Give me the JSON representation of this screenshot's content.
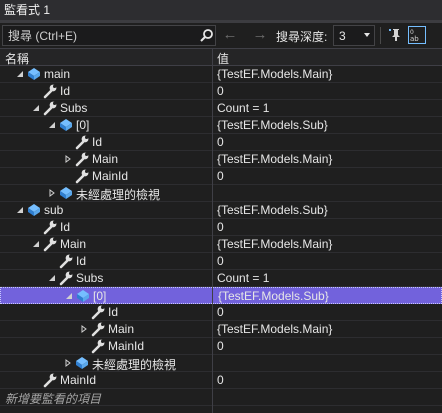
{
  "window": {
    "title": "監看式 1"
  },
  "toolbar": {
    "search_placeholder": "搜尋 (Ctrl+E)",
    "depth_label": "搜尋深度:",
    "depth_value": "3"
  },
  "columns": {
    "name": "名稱",
    "value": "值"
  },
  "rows": [
    {
      "level": 0,
      "expander": "expanded",
      "icon": "object-icon",
      "name": "main",
      "value": "{TestEF.Models.Main}"
    },
    {
      "level": 1,
      "expander": "none",
      "icon": "wrench-icon",
      "name": "Id",
      "value": "0"
    },
    {
      "level": 1,
      "expander": "expanded",
      "icon": "wrench-icon",
      "name": "Subs",
      "value": "Count = 1"
    },
    {
      "level": 2,
      "expander": "expanded",
      "icon": "object-icon",
      "name": "[0]",
      "value": "{TestEF.Models.Sub}"
    },
    {
      "level": 3,
      "expander": "none",
      "icon": "wrench-icon",
      "name": "Id",
      "value": "0"
    },
    {
      "level": 3,
      "expander": "collapsed",
      "icon": "wrench-icon",
      "name": "Main",
      "value": "{TestEF.Models.Main}"
    },
    {
      "level": 3,
      "expander": "none",
      "icon": "wrench-icon",
      "name": "MainId",
      "value": "0"
    },
    {
      "level": 2,
      "expander": "collapsed",
      "icon": "object-icon",
      "name": "未經處理的檢視",
      "value": ""
    },
    {
      "level": 0,
      "expander": "expanded",
      "icon": "object-icon",
      "name": "sub",
      "value": "{TestEF.Models.Sub}"
    },
    {
      "level": 1,
      "expander": "none",
      "icon": "wrench-icon",
      "name": "Id",
      "value": "0"
    },
    {
      "level": 1,
      "expander": "expanded",
      "icon": "wrench-icon",
      "name": "Main",
      "value": "{TestEF.Models.Main}"
    },
    {
      "level": 2,
      "expander": "none",
      "icon": "wrench-icon",
      "name": "Id",
      "value": "0"
    },
    {
      "level": 2,
      "expander": "expanded",
      "icon": "wrench-icon",
      "name": "Subs",
      "value": "Count = 1"
    },
    {
      "level": 3,
      "expander": "expanded",
      "icon": "object-icon",
      "name": "[0]",
      "value": "{TestEF.Models.Sub}",
      "selected": true
    },
    {
      "level": 4,
      "expander": "none",
      "icon": "wrench-icon",
      "name": "Id",
      "value": "0"
    },
    {
      "level": 4,
      "expander": "collapsed",
      "icon": "wrench-icon",
      "name": "Main",
      "value": "{TestEF.Models.Main}"
    },
    {
      "level": 4,
      "expander": "none",
      "icon": "wrench-icon",
      "name": "MainId",
      "value": "0"
    },
    {
      "level": 3,
      "expander": "collapsed",
      "icon": "object-icon",
      "name": "未經處理的檢視",
      "value": ""
    },
    {
      "level": 1,
      "expander": "none",
      "icon": "wrench-icon",
      "name": "MainId",
      "value": "0"
    }
  ],
  "add_watch_placeholder": "新增要監看的項目",
  "colors": {
    "accent": "#7262dc",
    "background": "#1f1f1f",
    "text": "#e6e6e6"
  }
}
